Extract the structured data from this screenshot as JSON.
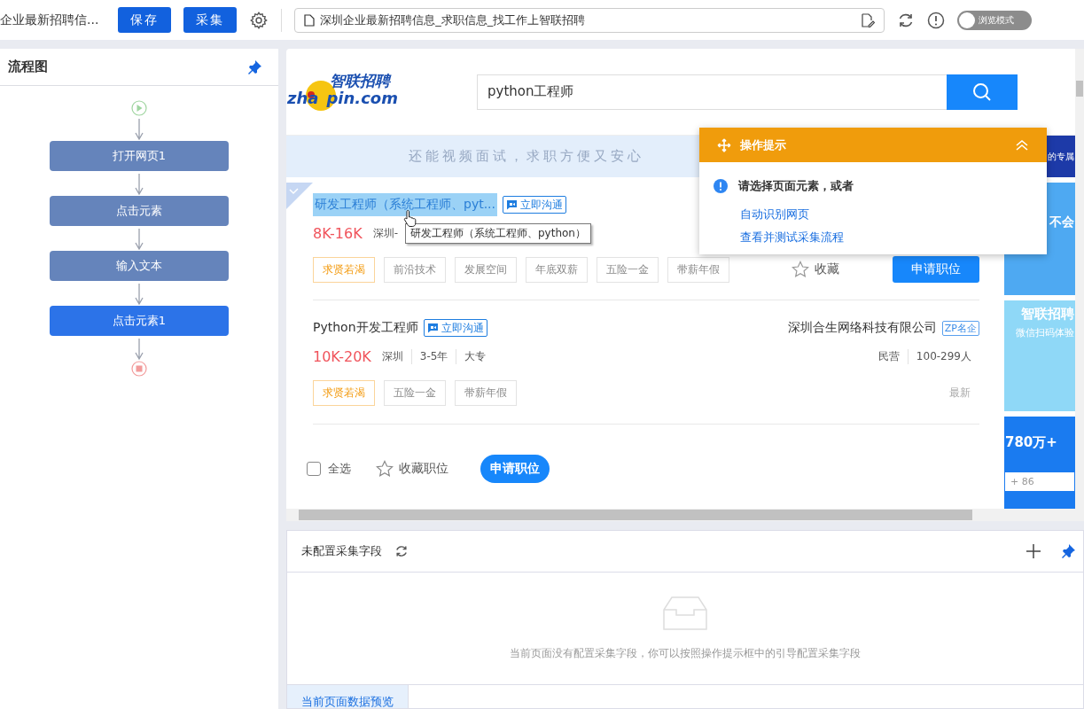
{
  "top_bar": {
    "page_title": "企业最新招聘信...",
    "buttons": [
      {
        "label": "保存"
      },
      {
        "label": "采集"
      }
    ],
    "url": "深圳企业最新招聘信息_求职信息_找工作上智联招聘",
    "browse_mode": {
      "label": "浏览模式",
      "on": false
    }
  },
  "flowchart": {
    "title": "流程图",
    "nodes": [
      {
        "label": "打开网页1",
        "selected": false
      },
      {
        "label": "点击元素",
        "selected": false
      },
      {
        "label": "输入文本",
        "selected": false
      },
      {
        "label": "点击元素1",
        "selected": true
      }
    ]
  },
  "browser": {
    "logo": {
      "cn": "智联招聘",
      "en_left": "zha",
      "en_right": "pin.com"
    },
    "search": {
      "value": "python工程师"
    },
    "banner": "还能视频面试，求职方便又安心",
    "jobs": [
      {
        "title": "研发工程师（系统工程师、pyt...",
        "selected": true,
        "chat": "立即沟通",
        "salary": "8K-16K",
        "meta": [
          "深圳-"
        ],
        "tooltip": "研发工程师（系统工程师、python）",
        "tags": [
          {
            "label": "求贤若渴",
            "highlight": true
          },
          {
            "label": "前沿技术",
            "highlight": false
          },
          {
            "label": "发展空间",
            "highlight": false
          },
          {
            "label": "年底双薪",
            "highlight": false
          },
          {
            "label": "五险一金",
            "highlight": false
          },
          {
            "label": "带薪年假",
            "highlight": false
          }
        ],
        "collect": "收藏",
        "apply": "申请职位"
      },
      {
        "title": "Python开发工程师",
        "selected": false,
        "chat": "立即沟通",
        "salary": "10K-20K",
        "meta": [
          "深圳",
          "3-5年",
          "大专"
        ],
        "company": "深圳合生网络科技有限公司",
        "company_badge": "ZP名企",
        "company_meta": [
          "民营",
          "100-299人"
        ],
        "tags": [
          {
            "label": "求贤若渴",
            "highlight": true
          },
          {
            "label": "五险一金",
            "highlight": false
          },
          {
            "label": "带薪年假",
            "highlight": false
          }
        ],
        "time": "最新"
      }
    ],
    "footer": {
      "select_all": {
        "label": "全选",
        "checked": false
      },
      "collect": "收藏职位",
      "apply": "申请职位"
    },
    "ads": {
      "top": "的专属",
      "second": "不会",
      "third_title": "智联招聘",
      "third_sub": "微信扫码体验",
      "fourth": "780万+",
      "phone_prefix": "+ 86"
    }
  },
  "popup": {
    "title": "操作提示",
    "message": "请选择页面元素，或者",
    "links": [
      "自动识别网页",
      "查看并测试采集流程"
    ]
  },
  "fields_panel": {
    "title": "未配置采集字段",
    "empty_message": "当前页面没有配置采集字段，你可以按照操作提示框中的引导配置采集字段",
    "tabs": [
      {
        "label": "当前页面数据预览",
        "selected": true
      }
    ]
  }
}
